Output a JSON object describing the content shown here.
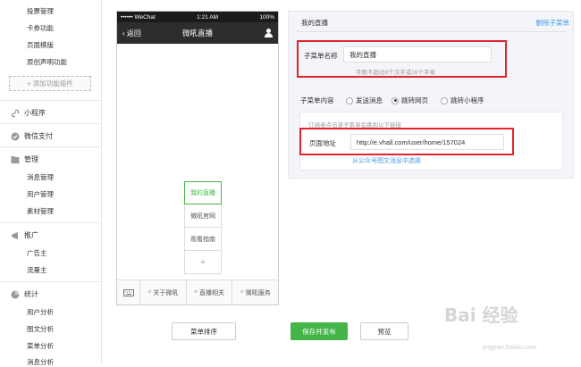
{
  "sidebar": {
    "items_top": [
      "投票管理",
      "卡券功能",
      "页面模版",
      "原创声明功能"
    ],
    "add_plugin": "+ 添加功能插件",
    "mini_program": "小程序",
    "wechat_pay": "微信支付",
    "manage": {
      "title": "管理",
      "items": [
        "消息管理",
        "用户管理",
        "素材管理"
      ]
    },
    "promote": {
      "title": "推广",
      "items": [
        "广告主",
        "流量主"
      ]
    },
    "stats": {
      "title": "统计",
      "items": [
        "用户分析",
        "图文分析",
        "菜单分析",
        "消息分析"
      ]
    }
  },
  "phone": {
    "carrier": "•••••• WeChat",
    "time": "1:21 AM",
    "battery": "100%",
    "back": "返回",
    "title": "微吼直播",
    "submenu": [
      "我的直播",
      "微吼官网",
      "观看指南",
      "+"
    ],
    "menu": [
      "关于微吼",
      "直播相关",
      "微吼服务"
    ]
  },
  "panel": {
    "title": "我的直播",
    "delete_link": "删除子菜单",
    "name_label": "子菜单名称",
    "name_value": "我的直播",
    "name_hint": "字数不超过8个汉字或16个字母",
    "content_label": "子菜单内容",
    "options": [
      "发送消息",
      "跳转网页",
      "跳转小程序"
    ],
    "selected_option": "跳转网页",
    "sub_hint": "订阅者点击该子菜单会跳到以下链接",
    "url_label": "页面地址",
    "url_value": "http://e.vhall.com/user/home/157024",
    "select_link": "从公众号图文消息中选择"
  },
  "buttons": {
    "sort": "菜单排序",
    "publish": "保存并发布",
    "preview": "预览"
  },
  "watermark": {
    "main": "Bai 经验",
    "sub": "jingyan.baidu.com"
  },
  "colors": {
    "accent_green": "#44b549",
    "link_blue": "#459ae9",
    "highlight_red": "#e0242e"
  }
}
